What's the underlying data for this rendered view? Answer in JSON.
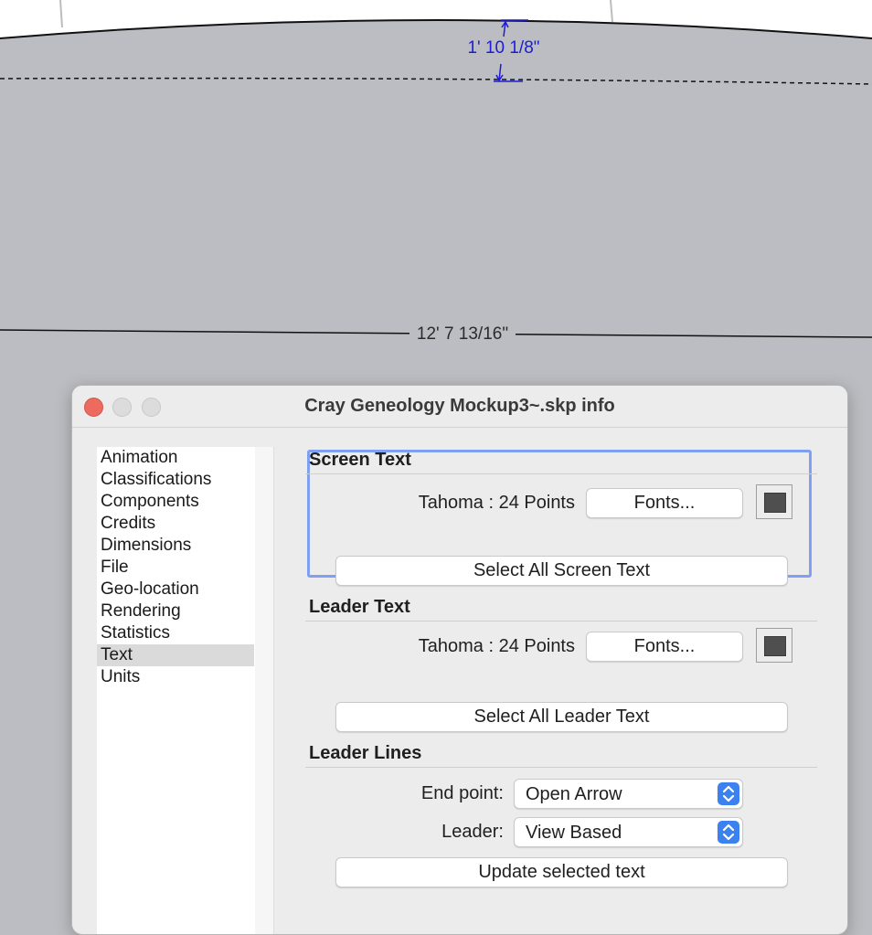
{
  "canvas": {
    "dimension_top": "1' 10 1/8\"",
    "dimension_bottom": "12' 7 13/16\""
  },
  "window": {
    "title": "Cray Geneology Mockup3~.skp info"
  },
  "sidebar": {
    "items": [
      {
        "label": "Animation"
      },
      {
        "label": "Classifications"
      },
      {
        "label": "Components"
      },
      {
        "label": "Credits"
      },
      {
        "label": "Dimensions"
      },
      {
        "label": "File"
      },
      {
        "label": "Geo-location"
      },
      {
        "label": "Rendering"
      },
      {
        "label": "Statistics"
      },
      {
        "label": "Text",
        "selected": true
      },
      {
        "label": "Units"
      }
    ]
  },
  "screen_text": {
    "title": "Screen Text",
    "font_label": "Tahoma : 24 Points",
    "fonts_button": "Fonts...",
    "select_all_button": "Select All Screen Text",
    "color": "#4f4f4f"
  },
  "leader_text": {
    "title": "Leader Text",
    "font_label": "Tahoma : 24 Points",
    "fonts_button": "Fonts...",
    "select_all_button": "Select All Leader Text",
    "color": "#4f4f4f"
  },
  "leader_lines": {
    "title": "Leader Lines",
    "end_point_label": "End point:",
    "end_point_value": "Open Arrow",
    "leader_label": "Leader:",
    "leader_value": "View Based",
    "update_button": "Update selected text"
  },
  "colors": {
    "accent": "#3b82f0",
    "focus_ring": "#7f9ff0",
    "dimension_text": "#1c1cd8",
    "close_button": "#ed6a5e"
  }
}
